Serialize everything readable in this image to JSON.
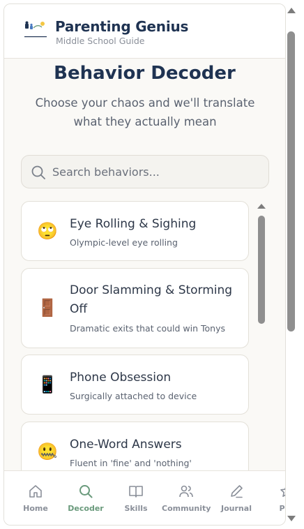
{
  "header": {
    "title": "Parenting Genius",
    "subtitle": "Middle School Guide",
    "logo_text": "Parenting Genius"
  },
  "hero": {
    "title": "Behavior Decoder",
    "subtitle": "Choose your chaos and we'll translate what they actually mean"
  },
  "search": {
    "placeholder": "Search behaviors...",
    "value": ""
  },
  "behaviors": [
    {
      "emoji": "🙄",
      "icon": "eye-roll-emoji",
      "title": "Eye Rolling & Sighing",
      "description": "Olympic-level eye rolling"
    },
    {
      "emoji": "🚪",
      "icon": "door-emoji",
      "title": "Door Slamming & Storming Off",
      "description": "Dramatic exits that could win Tonys"
    },
    {
      "emoji": "📱",
      "icon": "phone-emoji",
      "title": "Phone Obsession",
      "description": "Surgically attached to device"
    },
    {
      "emoji": "🤐",
      "icon": "zipper-mouth-emoji",
      "title": "One-Word Answers",
      "description": "Fluent in 'fine' and 'nothing'"
    }
  ],
  "nav": {
    "items": [
      {
        "label": "Home",
        "icon": "home-icon"
      },
      {
        "label": "Decoder",
        "icon": "search-icon",
        "active": true
      },
      {
        "label": "Skills",
        "icon": "book-icon"
      },
      {
        "label": "Community",
        "icon": "users-icon"
      },
      {
        "label": "Journal",
        "icon": "pencil-icon"
      },
      {
        "label": "Pro",
        "icon": "star-icon"
      }
    ]
  },
  "colors": {
    "primary": "#1f3352",
    "accent": "#6a9a7c",
    "background": "#faf9f6"
  }
}
